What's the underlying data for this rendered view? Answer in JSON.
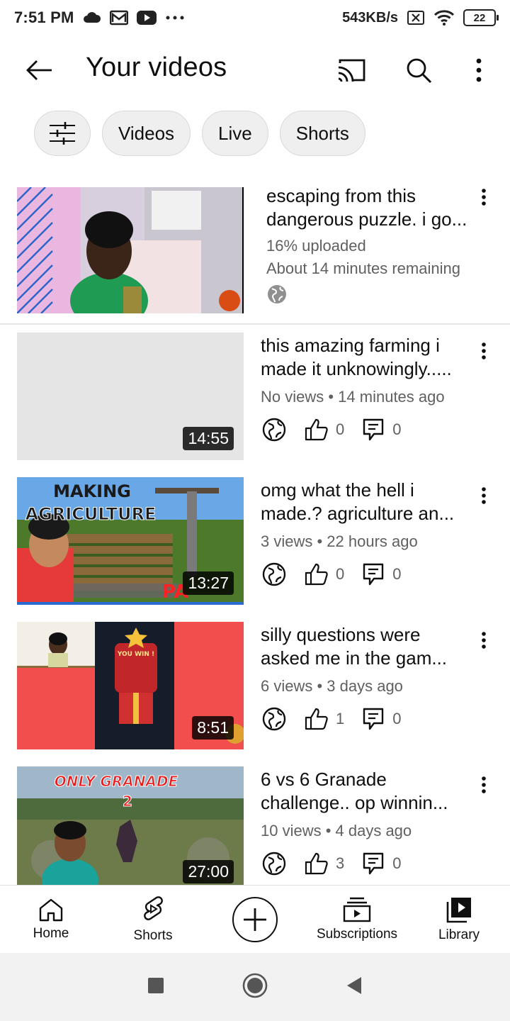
{
  "status_bar": {
    "time": "7:51 PM",
    "speed": "543KB/s",
    "battery": "22",
    "icons": [
      "cloud-icon",
      "gmail-icon",
      "youtube-icon",
      "more-dots-icon",
      "sim-off-icon",
      "wifi-icon",
      "battery-icon"
    ]
  },
  "app_bar": {
    "title": "Your videos",
    "actions": [
      "cast-icon",
      "search-icon",
      "more-vert-icon"
    ]
  },
  "chips": {
    "filter_icon": "tune-icon",
    "items": [
      "Videos",
      "Live",
      "Shorts"
    ]
  },
  "upload": {
    "title_line1": "escaping from this",
    "title_line2": "dangerous puzzle. i go...",
    "progress_text": "16% uploaded",
    "progress": 0.16,
    "remaining": "About 14 minutes remaining",
    "visibility_icon": "globe-icon"
  },
  "videos": [
    {
      "title_line1": "this amazing farming i",
      "title_line2": "made it unknowingly.....",
      "meta": "No views • 14 minutes ago",
      "duration": "14:55",
      "likes": "0",
      "comments": "0"
    },
    {
      "title_line1": "omg what the hell i",
      "title_line2": "made.? agriculture an...",
      "meta": "3 views • 22 hours ago",
      "duration": "13:27",
      "likes": "0",
      "comments": "0",
      "thumb_text1": "MAKING",
      "thumb_text2": "AGRICULTURE",
      "thumb_corner": "PA"
    },
    {
      "title_line1": "silly questions were",
      "title_line2": "asked me in the gam...",
      "meta": "6 views • 3 days ago",
      "duration": "8:51",
      "likes": "1",
      "comments": "0",
      "thumb_text1": "YOU WIN !"
    },
    {
      "title_line1": "6 vs 6 Granade",
      "title_line2": "challenge.. op winnin...",
      "meta": "10 views • 4 days ago",
      "duration": "27:00",
      "likes": "3",
      "comments": "0",
      "thumb_text1": "ONLY GRANADE",
      "thumb_text2": "2"
    }
  ],
  "bottom_nav": {
    "home": "Home",
    "shorts": "Shorts",
    "subscriptions": "Subscriptions",
    "library": "Library"
  },
  "colors": {
    "text_primary": "#0f0f0f",
    "text_secondary": "#606060",
    "chip_bg": "#efefef",
    "placeholder": "#e5e5e5"
  }
}
